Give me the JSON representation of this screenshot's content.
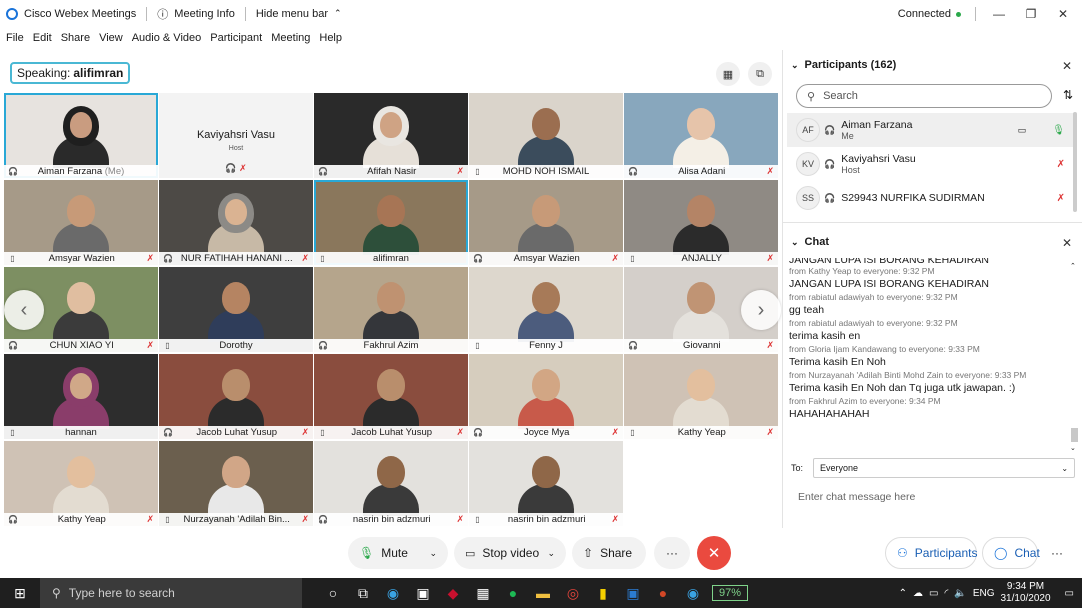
{
  "titlebar": {
    "app_title": "Cisco Webex Meetings",
    "meeting_info": "Meeting Info",
    "hide_menu": "Hide menu bar",
    "status": "Connected"
  },
  "menu": [
    "File",
    "Edit",
    "Share",
    "View",
    "Audio & Video",
    "Participant",
    "Meeting",
    "Help"
  ],
  "speaking": {
    "prefix": "Speaking:",
    "name": "alifimran"
  },
  "grid": {
    "host_tile": {
      "name": "Kaviyahsri Vasu",
      "role": "Host"
    },
    "tiles": [
      {
        "name": "Aiman Farzana",
        "suffix": "(Me)",
        "muted": false,
        "active": true,
        "bg": "#e7e3df",
        "shirt": "#2a2a2a",
        "skin": "#c99c80",
        "hijab": "#1f1f1f"
      },
      {
        "name": "Kaviyahsri Vasu",
        "host": true
      },
      {
        "name": "Afifah Nasir",
        "muted": true,
        "bg": "#2a2a2a",
        "shirt": "#e6e0d8",
        "skin": "#cfa384",
        "hijab": "#e9e6e1"
      },
      {
        "name": "MOHD NOH ISMAIL",
        "muted": false,
        "bg": "#dad4cb",
        "shirt": "#3b4c5c",
        "skin": "#9b6e50"
      },
      {
        "name": "Alisa Adani",
        "muted": true,
        "bg": "#88a7bd",
        "shirt": "#f4efe6",
        "skin": "#e6c4aa"
      },
      {
        "name": "Amsyar Wazien",
        "muted": true,
        "bg": "#a69a88",
        "shirt": "#6a6a6a",
        "skin": "#c79a78"
      },
      {
        "name": "NUR FATIHAH HANANI ...",
        "muted": true,
        "bg": "#4d4a46",
        "shirt": "#c7b9a6",
        "skin": "#dab392",
        "hijab": "#8c8a86"
      },
      {
        "name": "alifimran",
        "muted": false,
        "active": true,
        "bg": "#8a775c",
        "shirt": "#2d4f3a",
        "skin": "#a77555"
      },
      {
        "name": "Amsyar Wazien",
        "muted": true,
        "bg": "#a69a88",
        "shirt": "#6a6a6a",
        "skin": "#c79a78"
      },
      {
        "name": "ANJALLY",
        "muted": true,
        "bg": "#8f8a84",
        "shirt": "#2b2b2b",
        "skin": "#b48466"
      },
      {
        "name": "CHUN XIAO YI",
        "muted": true,
        "bg": "#7d8f62",
        "shirt": "#3b3b3b",
        "skin": "#e0bea0"
      },
      {
        "name": "Dorothy",
        "muted": false,
        "bg": "#3e3e3e",
        "shirt": "#2f3d5a",
        "skin": "#b58462"
      },
      {
        "name": "Fakhrul Azim",
        "muted": false,
        "bg": "#b5a58c",
        "shirt": "#34363a",
        "skin": "#bf9271"
      },
      {
        "name": "Fenny J",
        "muted": false,
        "bg": "#ddd7cd",
        "shirt": "#4c5c7d",
        "skin": "#a77a58"
      },
      {
        "name": "Giovanni",
        "muted": true,
        "bg": "#d4cfca",
        "shirt": "#e4e1dc",
        "skin": "#c09474"
      },
      {
        "name": "hannan",
        "muted": false,
        "bg": "#2d2d2d",
        "shirt": "#8a3d6a",
        "skin": "#d0a888",
        "hijab": "#8a3d6a"
      },
      {
        "name": "Jacob Luhat Yusup",
        "muted": true,
        "bg": "#8a4d3e",
        "shirt": "#2b2b2b",
        "skin": "#b98e6c"
      },
      {
        "name": "Jacob Luhat Yusup",
        "muted": true,
        "bg": "#8a4d3e",
        "shirt": "#2b2b2b",
        "skin": "#b98e6c"
      },
      {
        "name": "Joyce Mya",
        "muted": true,
        "bg": "#d6cdbe",
        "shirt": "#c85a4a",
        "skin": "#d2a684"
      },
      {
        "name": "Kathy Yeap",
        "muted": true,
        "bg": "#cfc2b5",
        "shirt": "#e3dcd1",
        "skin": "#e3bf9e"
      },
      {
        "name": "Kathy Yeap",
        "muted": true,
        "bg": "#cfc2b5",
        "shirt": "#e3dcd1",
        "skin": "#e3bf9e"
      },
      {
        "name": "Nurzayanah 'Adilah Bin...",
        "muted": true,
        "bg": "#6b5f4e",
        "shirt": "#e8e8e8",
        "skin": "#d1a687"
      },
      {
        "name": "nasrin bin adzmuri",
        "muted": true,
        "bg": "#e3e1dd",
        "shirt": "#3a3a3a",
        "skin": "#8f6748"
      },
      {
        "name": "nasrin bin adzmuri",
        "muted": true,
        "bg": "#e3e1dd",
        "shirt": "#3a3a3a",
        "skin": "#8f6748"
      }
    ]
  },
  "controls": {
    "mute": "Mute",
    "stop_video": "Stop video",
    "share": "Share",
    "more": "···",
    "participants": "Participants",
    "chat": "Chat"
  },
  "participants_panel": {
    "title": "Participants (162)",
    "search_placeholder": "Search",
    "rows": [
      {
        "initials": "AF",
        "name": "Aiman Farzana",
        "sub": "Me"
      },
      {
        "initials": "KV",
        "name": "Kaviyahsri Vasu",
        "sub": "Host"
      },
      {
        "initials": "SS",
        "name": "S29943 NURFIKA SUDIRMAN",
        "sub": ""
      }
    ]
  },
  "chat_panel": {
    "title": "Chat",
    "messages": [
      {
        "text": "JANGAN LUPA ISI BORANG KEHADIRAN",
        "meta": "from Kathy Yeap to everyone:   9:32 PM"
      },
      {
        "text": "JANGAN LUPA ISI BORANG KEHADIRAN",
        "meta": "from rabiatul adawiyah to everyone:   9:32 PM"
      },
      {
        "text": "gg teah",
        "meta": "from rabiatul adawiyah to everyone:   9:32 PM"
      },
      {
        "text": "terima kasih en",
        "meta": "from Gloria Ijam Kandawang to everyone:   9:33 PM"
      },
      {
        "text": "Terima kasih En Noh",
        "meta": "from Nurzayanah 'Adilah Binti Mohd Zain to everyone:   9:33 PM"
      },
      {
        "text": "Terima kasih En Noh dan Tq juga utk jawapan. :)",
        "meta": "from Fakhrul Azim to everyone:   9:34 PM"
      },
      {
        "text": "HAHAHAHAHAH",
        "meta": ""
      }
    ],
    "to_label": "To:",
    "to_value": "Everyone",
    "input_placeholder": "Enter chat message here"
  },
  "taskbar": {
    "search_placeholder": "Type here to search",
    "battery": "97%",
    "lang": "ENG",
    "time": "9:34 PM",
    "date": "31/10/2020"
  }
}
